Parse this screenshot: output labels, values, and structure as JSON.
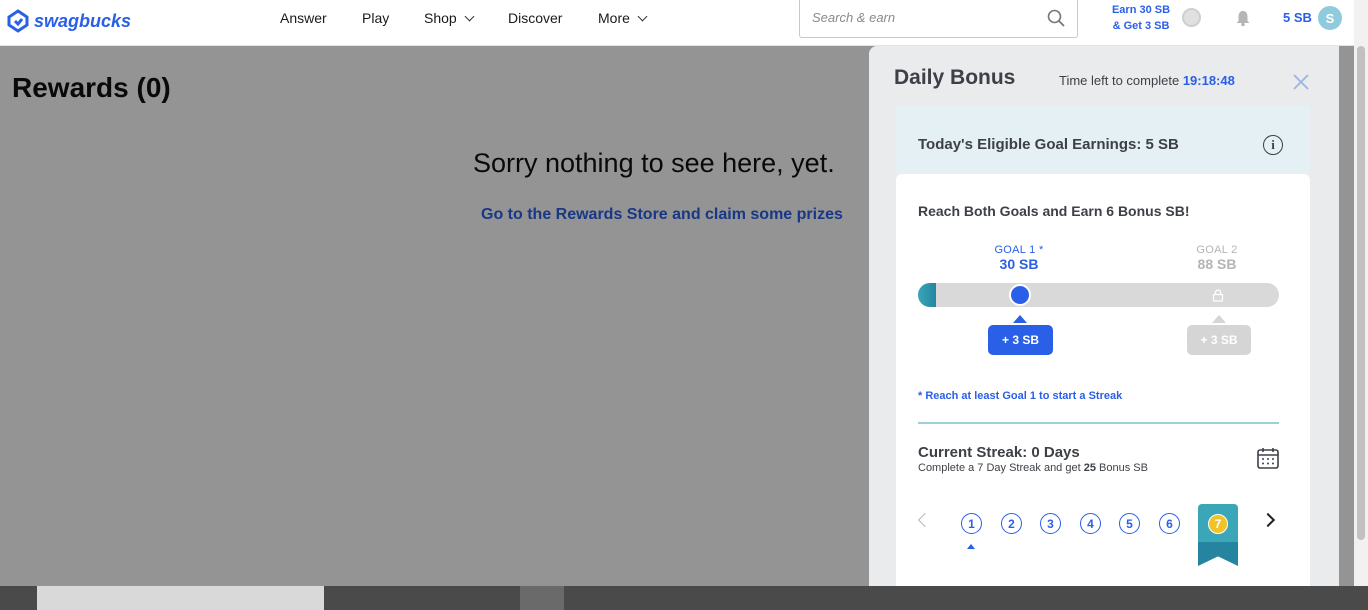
{
  "header": {
    "logo": "swagbucks",
    "nav": [
      {
        "label": "Answer",
        "has_dropdown": false
      },
      {
        "label": "Play",
        "has_dropdown": false
      },
      {
        "label": "Shop",
        "has_dropdown": true
      },
      {
        "label": "Discover",
        "has_dropdown": false
      },
      {
        "label": "More",
        "has_dropdown": true
      }
    ],
    "search": {
      "placeholder": "Search & earn",
      "value": ""
    },
    "earn_line1": "Earn 30 SB",
    "earn_line2": "& Get 3 SB",
    "balance": "5 SB",
    "avatar_initial": "S"
  },
  "main": {
    "title": "Rewards (0)",
    "empty_message": "Sorry nothing to see here, yet.",
    "store_link": "Go to the Rewards Store and claim some prizes"
  },
  "daily_bonus": {
    "title": "Daily Bonus",
    "time_left_label": "Time left to complete",
    "time_left_value": "19:18:48",
    "eligible": "Today's Eligible Goal Earnings: 5 SB",
    "reach": "Reach Both Goals and Earn 6 Bonus SB!",
    "goal1_label": "GOAL 1 *",
    "goal1_value": "30 SB",
    "goal1_reward": "+ 3 SB",
    "goal2_label": "GOAL 2",
    "goal2_value": "88 SB",
    "goal2_reward": "+ 3 SB",
    "progress_earned": 5,
    "streak_note": "* Reach at least Goal 1 to start a Streak",
    "current_streak": "Current Streak: 0 Days",
    "streak_sub_prefix": "Complete a 7 Day Streak and get ",
    "streak_sub_bonus": "25",
    "streak_sub_suffix": " Bonus SB",
    "days": [
      "1",
      "2",
      "3",
      "4",
      "5",
      "6",
      "7"
    ],
    "current_day": "1"
  },
  "colors": {
    "accent": "#2a5fe8",
    "teal": "#3aa6b8",
    "gold": "#f2c229"
  }
}
